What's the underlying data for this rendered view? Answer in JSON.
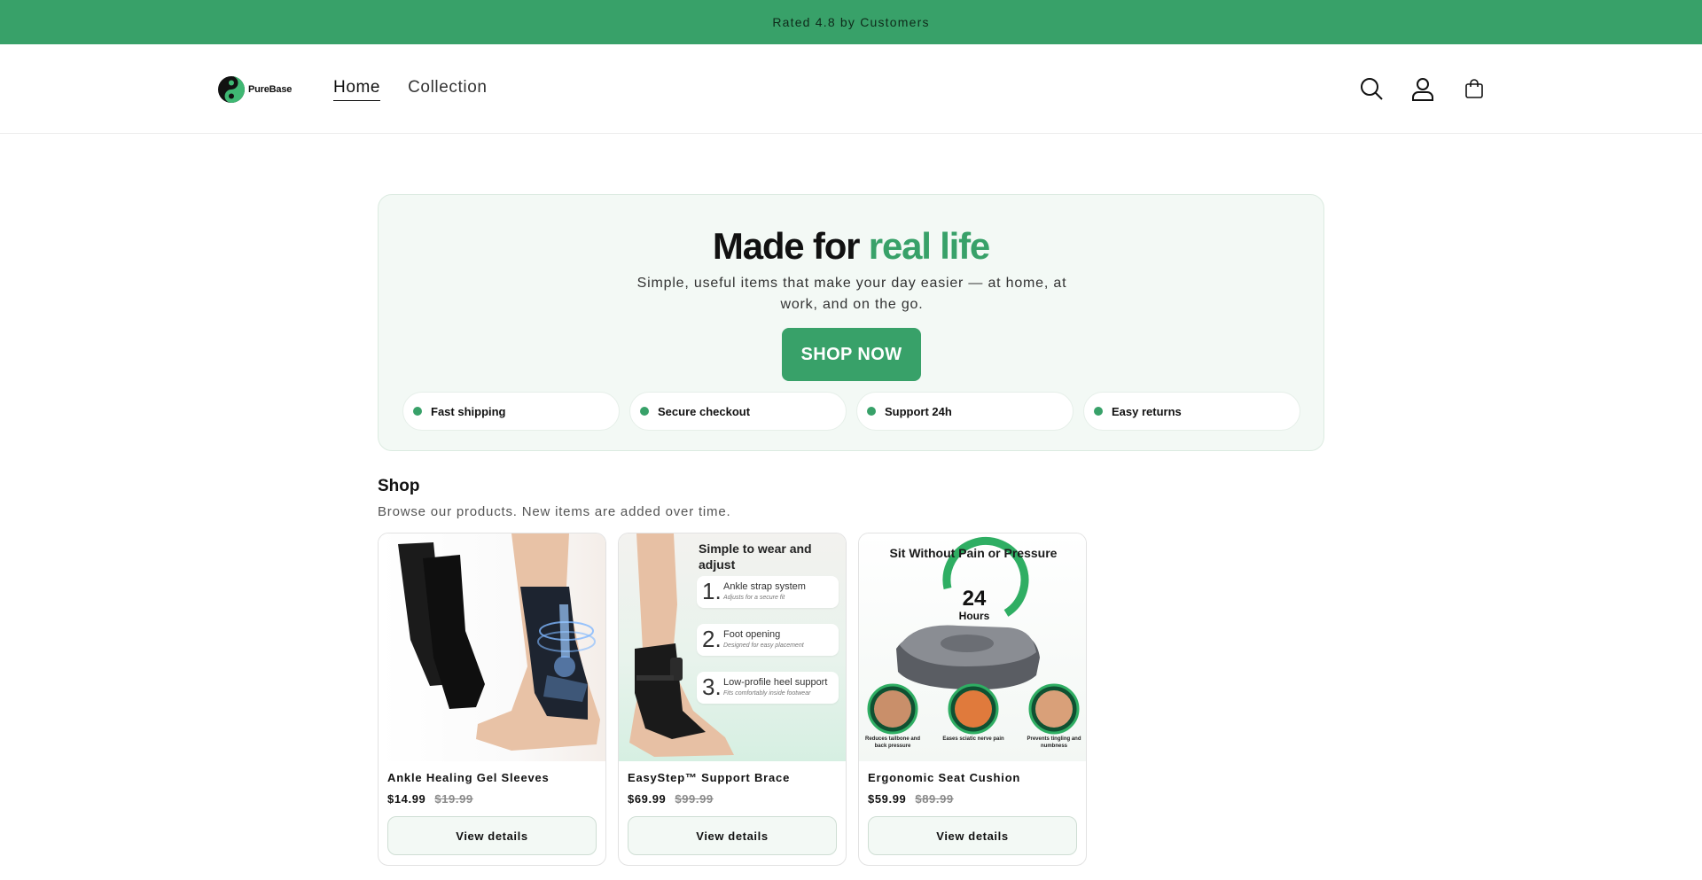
{
  "announcement": {
    "text": "Rated 4.8 by Customers"
  },
  "header": {
    "logo_text": "PureBase",
    "nav": [
      {
        "label": "Home",
        "active": true
      },
      {
        "label": "Collection",
        "active": false
      }
    ],
    "icons": [
      "search-icon",
      "account-icon",
      "cart-icon"
    ]
  },
  "hero": {
    "title_main": "Made for ",
    "title_accent": "real life",
    "subtitle": "Simple, useful items that make your day easier — at home, at work, and on the go.",
    "cta_label": "SHOP NOW",
    "features": [
      "Fast shipping",
      "Secure checkout",
      "Support 24h",
      "Easy returns"
    ]
  },
  "shop": {
    "title": "Shop",
    "subtitle": "Browse our products. New items are added over time.",
    "products": [
      {
        "name": "Ankle Healing Gel Sleeves",
        "price": "$14.99",
        "old_price": "$19.99",
        "button": "View details"
      },
      {
        "name": "EasyStep™ Support Brace",
        "price": "$69.99",
        "old_price": "$99.99",
        "button": "View details",
        "image_text": {
          "heading": "Simple to wear and adjust",
          "steps": [
            {
              "num": "1.",
              "title": "Ankle strap system",
              "sub": "Adjusts for a secure fit"
            },
            {
              "num": "2.",
              "title": "Foot opening",
              "sub": "Designed for easy placement"
            },
            {
              "num": "3.",
              "title": "Low-profile heel support",
              "sub": "Fits comfortably inside footwear"
            }
          ]
        }
      },
      {
        "name": "Ergonomic Seat Cushion",
        "price": "$59.99",
        "old_price": "$89.99",
        "button": "View details",
        "image_text": {
          "heading": "Sit Without Pain or Pressure",
          "badge_big": "24",
          "badge_small": "Hours",
          "captions": [
            "Reduces tailbone and back pressure",
            "Eases sciatic nerve pain",
            "Prevents tingling and numbness"
          ]
        }
      }
    ]
  },
  "colors": {
    "brand_green": "#38a169",
    "hero_bg": "#f3f9f5"
  }
}
